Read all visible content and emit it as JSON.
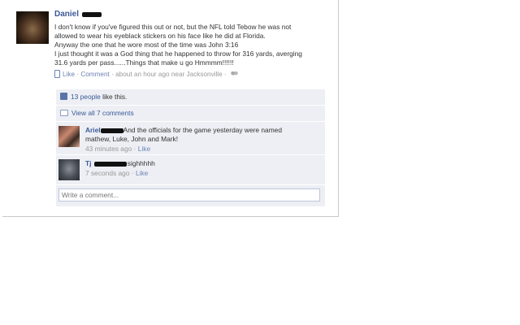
{
  "post": {
    "author": "Daniel",
    "lines": [
      "I don't know if you've figured this out or not, but the NFL told Tebow he was not",
      "allowed to wear his eyeblack stickers on his face like he did at Florida.",
      "Anyway the one that he wore most of the time was John 3:16",
      "I just thought it was a God thing that he happened to throw for 316 yards, averging",
      "31.6 yards per pass......Things that make u go Hmmmm!!!!!!"
    ],
    "actions": {
      "like": "Like",
      "comment": "Comment",
      "separator": "·",
      "time": "about an hour ago near Jacksonville"
    }
  },
  "ufi": {
    "likes_link": "13 people",
    "likes_suffix": " like this.",
    "view_all": "View all 7 comments",
    "comments": [
      {
        "name": "Ariel",
        "text": "And the officials for the game yesterday were named",
        "text2": "mathew, Luke, John and Mark!",
        "time": "43 minutes ago",
        "like": "Like"
      },
      {
        "name": "Tj",
        "text": "sighhhhh",
        "time": "7 seconds ago",
        "like": "Like"
      }
    ],
    "write_placeholder": "Write a comment..."
  },
  "colors": {
    "link": "#3b5998",
    "ufi_bg": "#edeff4",
    "meta": "#999999"
  }
}
